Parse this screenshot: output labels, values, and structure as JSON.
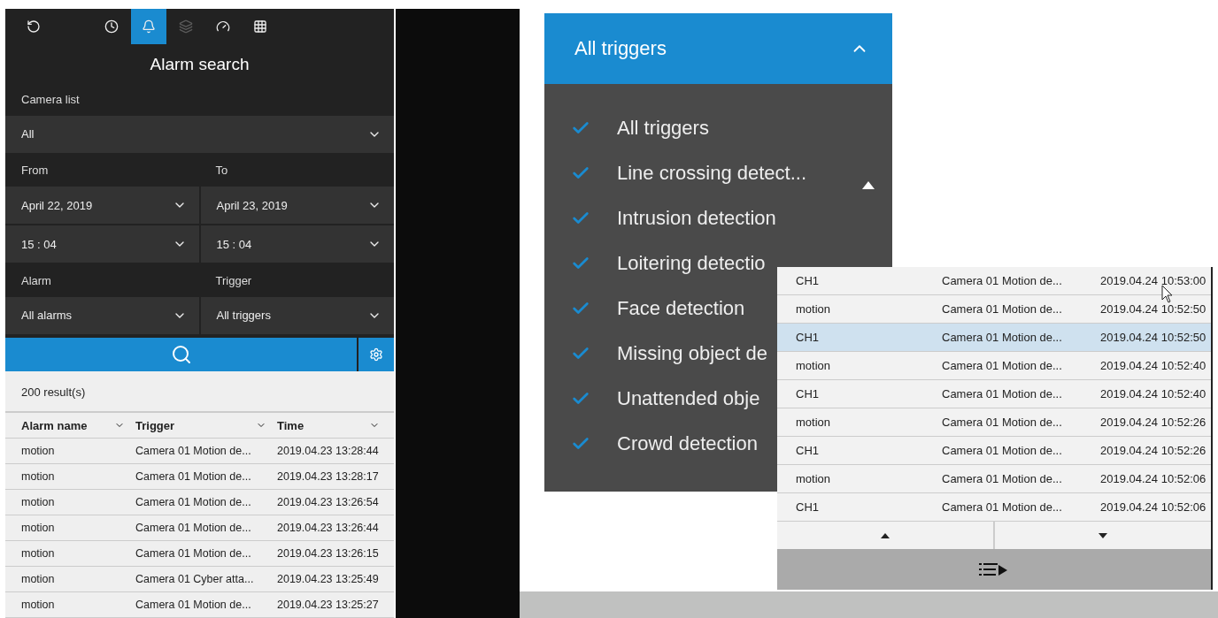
{
  "search_panel": {
    "toolbar": [
      {
        "kind": "eye-rotate",
        "selected": false,
        "disabled": false
      },
      {
        "kind": "clock",
        "selected": false,
        "disabled": false
      },
      {
        "kind": "bell",
        "selected": true,
        "disabled": false
      },
      {
        "kind": "stack",
        "selected": false,
        "disabled": true
      },
      {
        "kind": "gauge",
        "selected": false,
        "disabled": false
      },
      {
        "kind": "grid",
        "selected": false,
        "disabled": false
      }
    ],
    "title": "Alarm search",
    "camera_list": {
      "label": "Camera list",
      "value": "All"
    },
    "from": {
      "label": "From",
      "date": "April 22, 2019",
      "time": "15 : 04"
    },
    "to": {
      "label": "To",
      "date": "April 23, 2019",
      "time": "15 : 04"
    },
    "alarm": {
      "label": "Alarm",
      "value": "All alarms"
    },
    "trigger": {
      "label": "Trigger",
      "value": "All triggers"
    },
    "results_count": "200 result(s)",
    "columns": [
      "Alarm name",
      "Trigger",
      "Time"
    ],
    "rows": [
      [
        "motion",
        "Camera 01 Motion de...",
        "2019.04.23 13:28:44"
      ],
      [
        "motion",
        "Camera 01 Motion de...",
        "2019.04.23 13:28:17"
      ],
      [
        "motion",
        "Camera 01 Motion de...",
        "2019.04.23 13:26:54"
      ],
      [
        "motion",
        "Camera 01 Motion de...",
        "2019.04.23 13:26:44"
      ],
      [
        "motion",
        "Camera 01 Motion de...",
        "2019.04.23 13:26:15"
      ],
      [
        "motion",
        "Camera 01 Cyber atta...",
        "2019.04.23 13:25:49"
      ],
      [
        "motion",
        "Camera 01 Motion de...",
        "2019.04.23 13:25:27"
      ]
    ]
  },
  "trigger_dropdown": {
    "value": "All triggers",
    "expanded": true,
    "items": [
      {
        "label": "All triggers",
        "checked": true
      },
      {
        "label": "Line crossing detect...",
        "checked": true
      },
      {
        "label": "Intrusion detection",
        "checked": true
      },
      {
        "label": "Loitering detectio",
        "checked": true
      },
      {
        "label": "Face detection",
        "checked": true
      },
      {
        "label": "Missing object de",
        "checked": true
      },
      {
        "label": "Unattended obje",
        "checked": true
      },
      {
        "label": "Crowd detection",
        "checked": true
      }
    ]
  },
  "results_table": {
    "rows": [
      {
        "cells": [
          "CH1",
          "Camera 01 Motion de...",
          "2019.04.24 10:53:00"
        ],
        "selected": false
      },
      {
        "cells": [
          "motion",
          "Camera 01 Motion de...",
          "2019.04.24 10:52:50"
        ],
        "selected": false
      },
      {
        "cells": [
          "CH1",
          "Camera 01 Motion de...",
          "2019.04.24 10:52:50"
        ],
        "selected": true
      },
      {
        "cells": [
          "motion",
          "Camera 01 Motion de...",
          "2019.04.24 10:52:40"
        ],
        "selected": false
      },
      {
        "cells": [
          "CH1",
          "Camera 01 Motion de...",
          "2019.04.24 10:52:40"
        ],
        "selected": false
      },
      {
        "cells": [
          "motion",
          "Camera 01 Motion de...",
          "2019.04.24 10:52:26"
        ],
        "selected": false
      },
      {
        "cells": [
          "CH1",
          "Camera 01 Motion de...",
          "2019.04.24 10:52:26"
        ],
        "selected": false
      },
      {
        "cells": [
          "motion",
          "Camera 01 Motion de...",
          "2019.04.24 10:52:06"
        ],
        "selected": false
      },
      {
        "cells": [
          "CH1",
          "Camera 01 Motion de...",
          "2019.04.24 10:52:06"
        ],
        "selected": false
      }
    ]
  }
}
